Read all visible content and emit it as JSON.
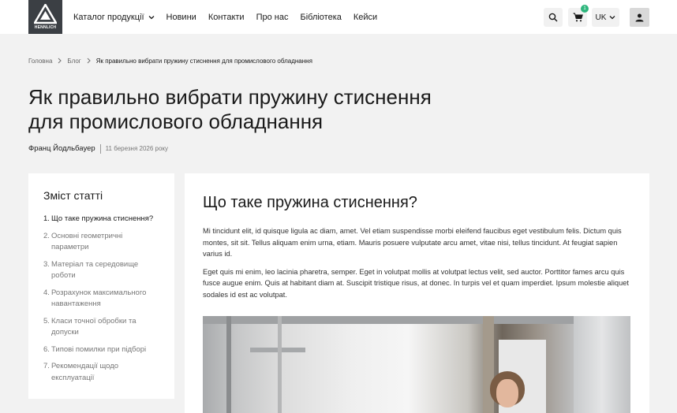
{
  "header": {
    "logo_text": "HENNLICH",
    "nav": [
      {
        "label": "Каталог продукції",
        "has_dropdown": true
      },
      {
        "label": "Новини"
      },
      {
        "label": "Контакти"
      },
      {
        "label": "Про нас"
      },
      {
        "label": "Бібліотека"
      },
      {
        "label": "Кейси"
      }
    ],
    "cart_count": "1",
    "language": "UK",
    "accent_color": "#2eb67d"
  },
  "breadcrumb": {
    "items": [
      "Головна",
      "Блог"
    ],
    "current": "Як правильно вибрати пружину стиснення для промислового обладнання"
  },
  "page_title": "Як правильно вибрати пружину стиснення для промислового обладнання",
  "meta": {
    "author": "Франц Йодльбауер",
    "date": "11 березня 2026 року"
  },
  "toc": {
    "title": "Зміст статті",
    "items": [
      {
        "num": "1.",
        "label": "Що таке пружина стиснення?",
        "active": true
      },
      {
        "num": "2.",
        "label": "Основні геометричні параметри"
      },
      {
        "num": "3.",
        "label": "Матеріал та середовище роботи"
      },
      {
        "num": "4.",
        "label": "Розрахунок максимального навантаження"
      },
      {
        "num": "5.",
        "label": "Класи точної обробки та допуски"
      },
      {
        "num": "6.",
        "label": "Типові помилки при підборі"
      },
      {
        "num": "7.",
        "label": "Рекомендації щодо експлуатації"
      }
    ]
  },
  "article": {
    "heading": "Що таке пружина стиснення?",
    "paragraphs": [
      "Mi tincidunt elit, id quisque ligula ac diam, amet. Vel etiam suspendisse morbi eleifend faucibus eget vestibulum felis. Dictum quis montes, sit sit. Tellus aliquam enim urna, etiam. Mauris posuere vulputate arcu amet, vitae nisi, tellus tincidunt. At feugiat sapien varius id.",
      "Eget quis mi enim, leo lacinia pharetra, semper. Eget in volutpat mollis at volutpat lectus velit, sed auctor. Porttitor fames arcu quis fusce augue enim. Quis at habitant diam at. Suscipit tristique risus, at donec. In turpis vel et quam imperdiet. Ipsum molestie aliquet sodales id est ac volutpat."
    ]
  }
}
